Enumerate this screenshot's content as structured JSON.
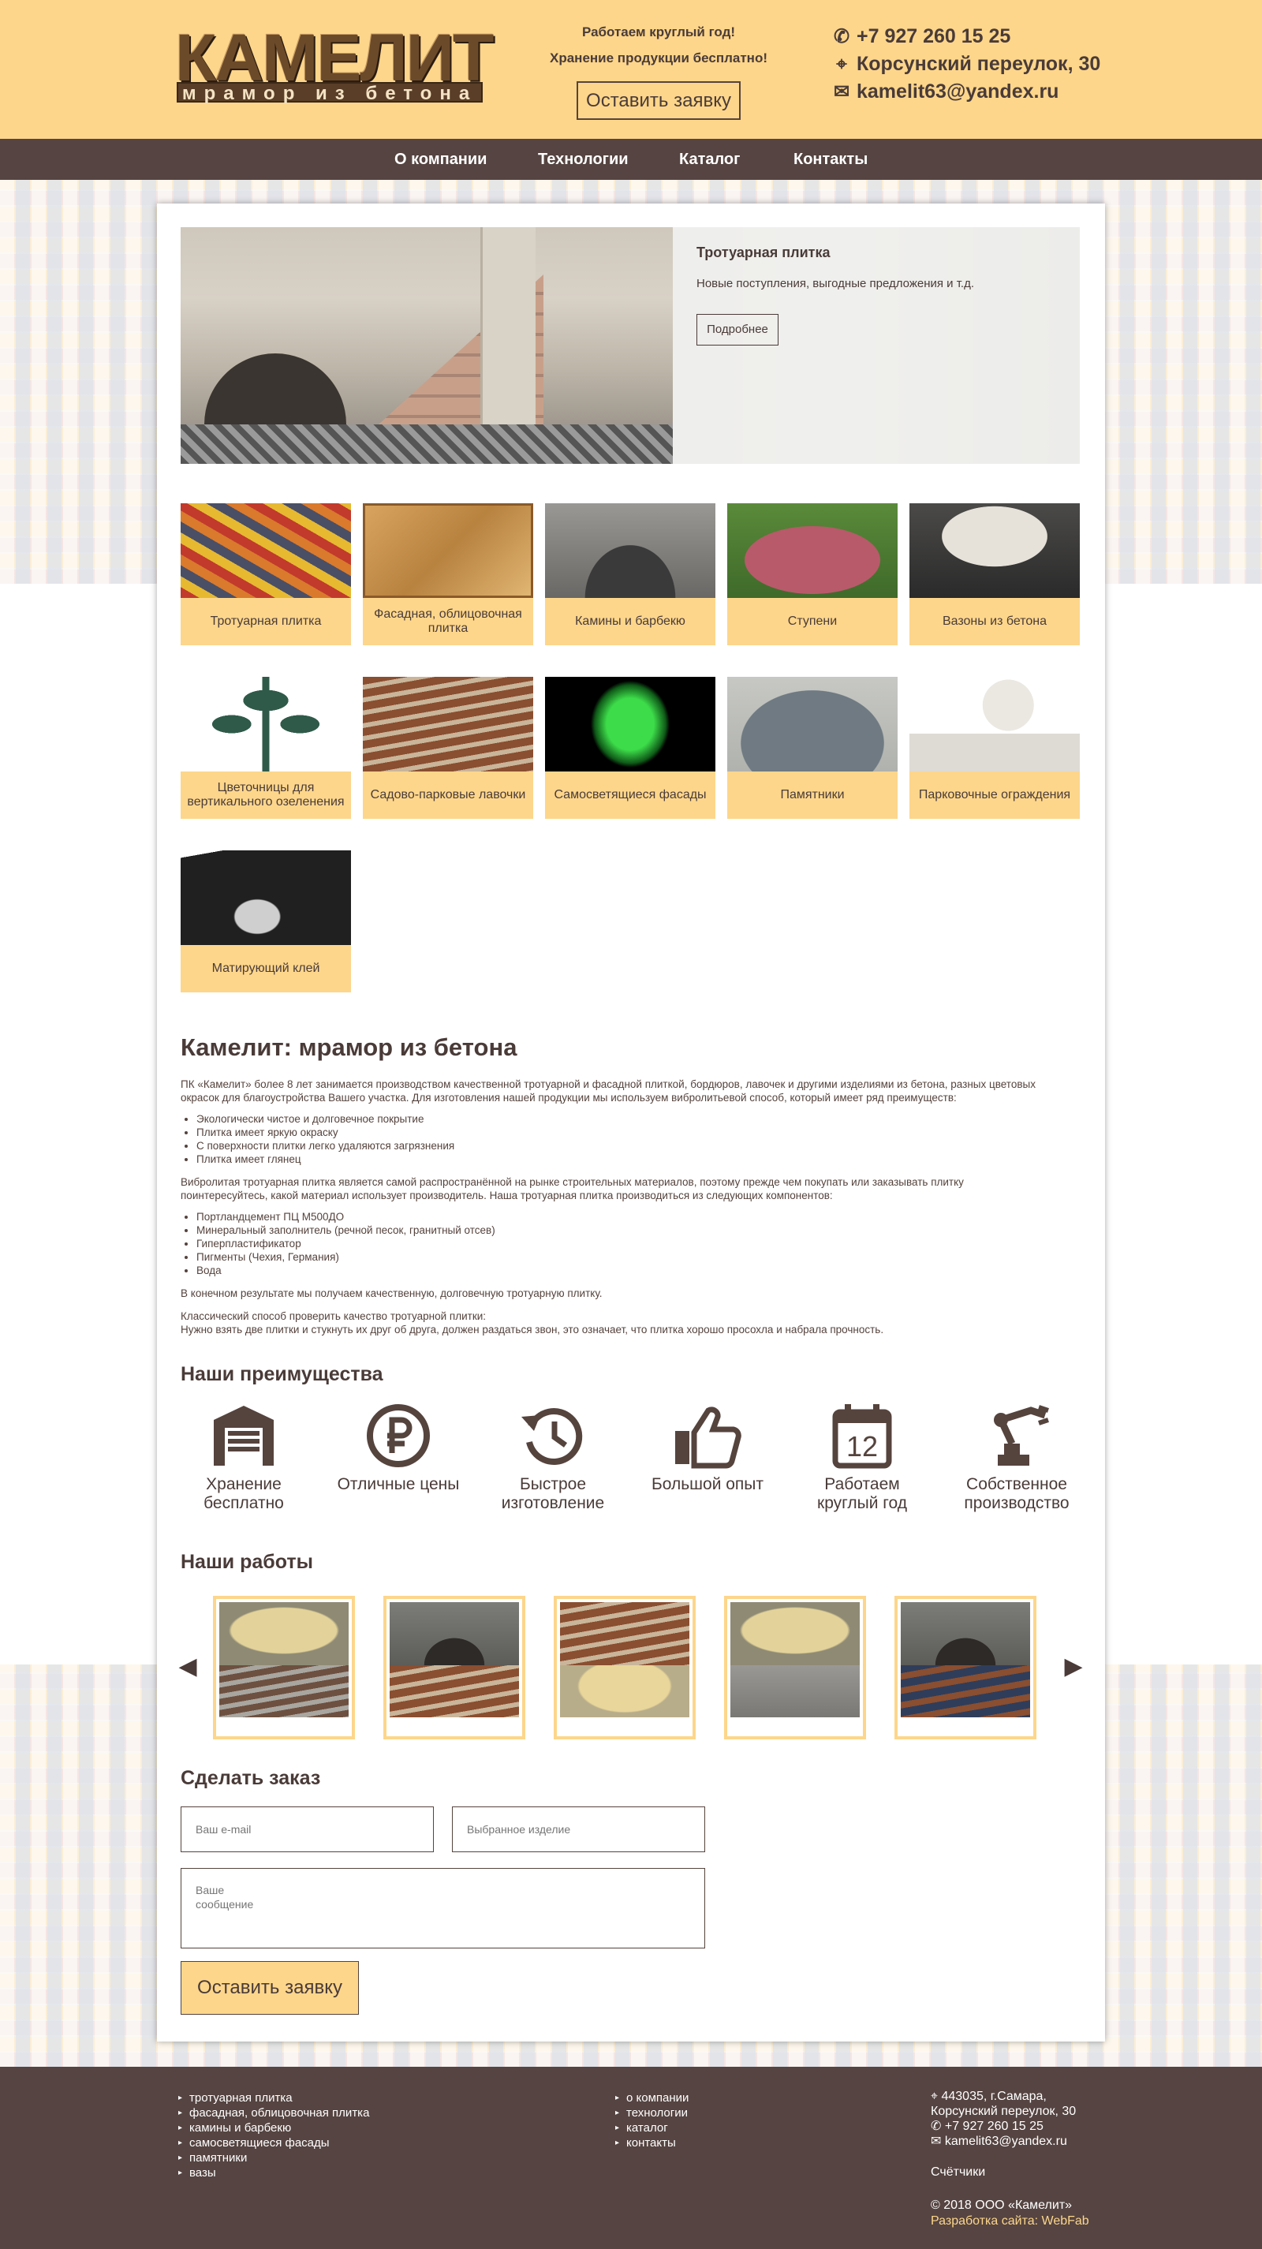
{
  "header": {
    "logo_text": "КАМЕЛИТ",
    "logo_subtitle": "мрамор из бетона",
    "tagline_1": "Работаем круглый год!",
    "tagline_2": "Хранение продукции бесплатно!",
    "cta_button": "Оставить заявку",
    "phone": "+7 927 260 15 25",
    "address": "Корсунский переулок, 30",
    "email": "kamelit63@yandex.ru"
  },
  "nav": [
    "О компании",
    "Технологии",
    "Каталог",
    "Контакты"
  ],
  "slider": {
    "title": "Тротуарная плитка",
    "text": "Новые поступления, выгодные предложения и т.д.",
    "button": "Подробнее"
  },
  "catalog": [
    {
      "label": "Тротуарная плитка"
    },
    {
      "label": "Фасадная, облицовочная плитка"
    },
    {
      "label": "Камины и барбекю"
    },
    {
      "label": "Ступени"
    },
    {
      "label": "Вазоны из бетона"
    },
    {
      "label": "Цветочницы для вертикального озеленения"
    },
    {
      "label": "Садово-парковые лавочки"
    },
    {
      "label": "Самосветящиеся фасады"
    },
    {
      "label": "Памятники"
    },
    {
      "label": "Парковочные ограждения"
    },
    {
      "label": "Матирующий клей"
    }
  ],
  "about": {
    "title": "Камелит: мрамор из бетона",
    "p1": "ПК «Камелит» более 8 лет занимается производством качественной тротуарной и фасадной плиткой, бордюров, лавочек и другими изделиями из бетона, разных цветовых окрасок для благоустройства Вашего участка. Для изготовления нашей продукции мы используем вибролитьевой способ, который имеет ряд преимуществ:",
    "list1": [
      "Экологически чистое и долговечное покрытие",
      "Плитка имеет яркую окраску",
      "С поверхности плитки легко удаляются загрязнения",
      "Плитка имеет глянец"
    ],
    "p2": "Вибролитая тротуарная плитка является самой распространённой на рынке строительных материалов, поэтому прежде чем покупать или заказывать плитку поинтересуйтесь, какой материал использует производитель. Наша тротуарная плитка производиться из следующих компонентов:",
    "list2": [
      "Портландцемент ПЦ М500ДО",
      "Минеральный заполнитель (речной песок, гранитный отсев)",
      "Гиперпластификатор",
      "Пигменты (Чехия, Германия)",
      "Вода"
    ],
    "p3": "В конечном результате мы получаем качественную, долговечную тротуарную плитку.",
    "p4a": "Классический способ проверить качество тротуарной плитки:",
    "p4b": "Нужно взять две плитки и стукнуть их друг об друга, должен раздаться звон, это означает, что плитка хорошо просохла и набрала прочность."
  },
  "advantages": {
    "title": "Наши преимущества",
    "items": [
      {
        "icon": "garage-icon",
        "label": "Хранение бесплатно"
      },
      {
        "icon": "ruble-icon",
        "label": "Отличные цены"
      },
      {
        "icon": "history-icon",
        "label": "Быстрое изготовление"
      },
      {
        "icon": "thumbs-up-icon",
        "label": "Большой опыт"
      },
      {
        "icon": "calendar-icon",
        "label": "Работаем круглый год",
        "day": "12"
      },
      {
        "icon": "robot-arm-icon",
        "label": "Собственное производство"
      }
    ]
  },
  "works": {
    "title": "Наши работы",
    "count": 5
  },
  "order": {
    "title": "Сделать заказ",
    "email_placeholder": "Ваш e-mail",
    "product_placeholder": "Выбранное изделие",
    "message_placeholder": "Ваше\nсообщение",
    "button": "Оставить заявку"
  },
  "footer": {
    "catalog_links": [
      "тротуарная плитка",
      "фасадная, облицовочная плитка",
      "камины и барбекю",
      "самосветящиеся фасады",
      "памятники",
      "вазы"
    ],
    "site_links": [
      "о компании",
      "технологии",
      "каталог",
      "контакты"
    ],
    "address_1": "443035, г.Самара,",
    "address_2": "Корсунский переулок, 30",
    "phone": "+7 927 260 15 25",
    "email": "kamelit63@yandex.ru",
    "counters": "Счётчики",
    "copyright": "© 2018 ООО «Камелит»",
    "developer": "Разработка сайта: WebFab"
  },
  "colors": {
    "accent": "#fdd68b",
    "dark": "#554441",
    "text": "#4a3b38"
  }
}
